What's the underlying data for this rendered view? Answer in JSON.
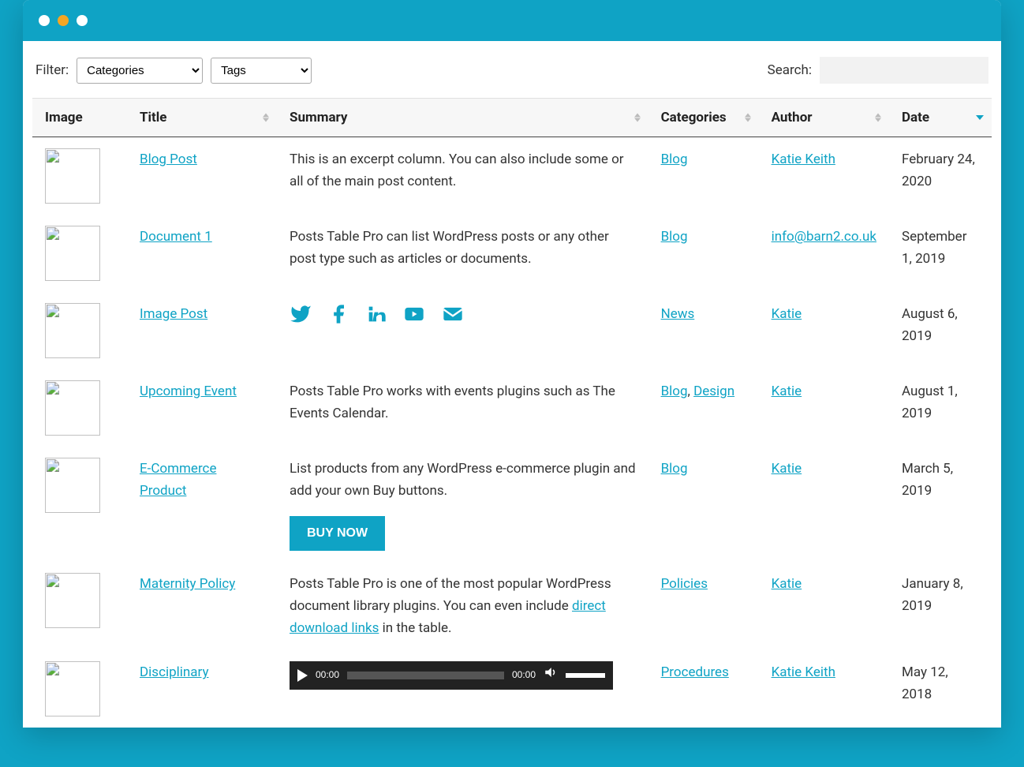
{
  "filter": {
    "label": "Filter:",
    "categories_select": "Categories",
    "tags_select": "Tags"
  },
  "search": {
    "label": "Search:",
    "value": ""
  },
  "headers": {
    "image": "Image",
    "title": "Title",
    "summary": "Summary",
    "categories": "Categories",
    "author": "Author",
    "date": "Date"
  },
  "rows": [
    {
      "title": "Blog Post",
      "summary_text": "This is an excerpt column. You can also include some or all of the main post content.",
      "categories": [
        "Blog"
      ],
      "author": "Katie Keith",
      "date": "February 24, 2020",
      "thumb": "pier"
    },
    {
      "title": "Document 1",
      "summary_text": "Posts Table Pro can list WordPress posts or any other post type such as articles or documents.",
      "categories": [
        "Blog"
      ],
      "author": "info@barn2.co.uk",
      "date": "September 1, 2019",
      "thumb": "road"
    },
    {
      "title": "Image Post",
      "summary_social": true,
      "categories": [
        "News"
      ],
      "author": "Katie",
      "date": "August 6, 2019",
      "thumb": "feet"
    },
    {
      "title": "Upcoming Event",
      "summary_text": "Posts Table Pro works with events plugins such as The Events Calendar.",
      "categories": [
        "Blog",
        "Design"
      ],
      "author": "Katie",
      "date": "August 1, 2019",
      "thumb": "sunset"
    },
    {
      "title": "E-Commerce Product",
      "summary_text": "List products from any WordPress e-commerce plugin and add your own Buy buttons.",
      "buy_button": "BUY NOW",
      "categories": [
        "Blog"
      ],
      "author": "Katie",
      "date": "March 5, 2019",
      "thumb": "tshirt"
    },
    {
      "title": "Maternity Policy",
      "summary_text_before": "Posts Table Pro is one of the most popular WordPress document library plugins. You can even include ",
      "summary_link": "direct download links",
      "summary_text_after": " in the table.",
      "categories": [
        "Policies"
      ],
      "author": "Katie",
      "date": "January 8, 2019",
      "thumb": "hands"
    },
    {
      "title": "Disciplinary",
      "summary_audio": {
        "current": "00:00",
        "total": "00:00"
      },
      "categories": [
        "Procedures"
      ],
      "author": "Katie Keith",
      "date": "May 12, 2018",
      "thumb": "laptop"
    }
  ],
  "category_separator": ", "
}
